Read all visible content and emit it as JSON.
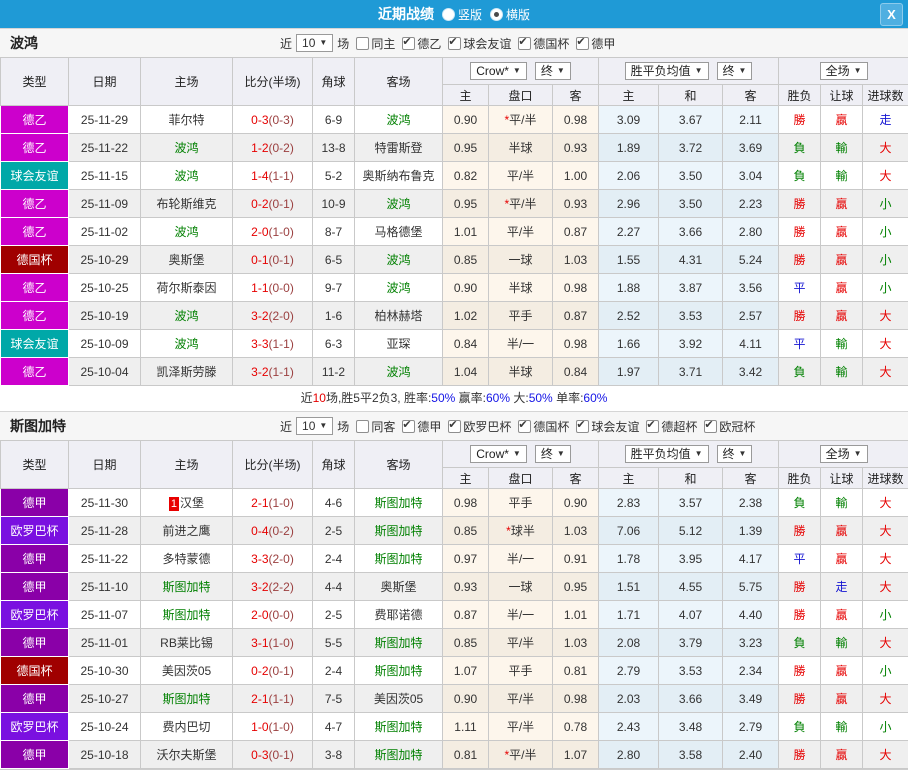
{
  "titlebar": {
    "title": "近期战绩",
    "layout_options": [
      {
        "label": "竖版",
        "selected": false
      },
      {
        "label": "横版",
        "selected": true
      }
    ],
    "close_label": "X"
  },
  "header_labels": {
    "near": "近",
    "games": "场",
    "main_cols": [
      "类型",
      "日期",
      "主场",
      "比分(半场)",
      "角球",
      "客场"
    ],
    "sub_cols": [
      "主",
      "盘口",
      "客",
      "主",
      "和",
      "客",
      "胜负",
      "让球",
      "进球数"
    ],
    "odds_source": "Crow*",
    "odds_final": "终",
    "avg_label": "胜平负均值",
    "avg_final": "终",
    "scope_label": "全场"
  },
  "league_colors": {
    "德乙": "#CC00CC",
    "球会友谊": "#00A8A8",
    "德国杯": "#A00000",
    "德甲": "#8A00A8",
    "欧罗巴杯": "#7A10E0"
  },
  "sections": [
    {
      "team": "波鸿",
      "filter": {
        "count": "10",
        "same": {
          "label": "同主",
          "checked": false
        },
        "leagues": [
          {
            "label": "德乙",
            "checked": true
          },
          {
            "label": "球会友谊",
            "checked": true
          },
          {
            "label": "德国杯",
            "checked": true
          },
          {
            "label": "德甲",
            "checked": true
          }
        ]
      },
      "rows": [
        {
          "lg": "德乙",
          "date": "25-11-29",
          "home": "菲尔特",
          "hg": false,
          "ft": "0-3",
          "ht": "(0-3)",
          "cn": "6-9",
          "away": "波鸿",
          "ag": true,
          "o1": "0.90",
          "st": true,
          "hc": "平/半",
          "o2": "0.98",
          "a1": "3.09",
          "a2": "3.67",
          "a3": "2.11",
          "r1": "勝",
          "c1": "r",
          "r2": "贏",
          "c2": "r",
          "r3": "走",
          "c3": "b"
        },
        {
          "lg": "德乙",
          "date": "25-11-22",
          "home": "波鸿",
          "hg": true,
          "ft": "1-2",
          "ht": "(0-2)",
          "cn": "13-8",
          "away": "特雷斯登",
          "ag": false,
          "o1": "0.95",
          "st": false,
          "hc": "半球",
          "o2": "0.93",
          "a1": "1.89",
          "a2": "3.72",
          "a3": "3.69",
          "r1": "負",
          "c1": "g",
          "r2": "輸",
          "c2": "g",
          "r3": "大",
          "c3": "r"
        },
        {
          "lg": "球会友谊",
          "date": "25-11-15",
          "home": "波鸿",
          "hg": true,
          "ft": "1-4",
          "ht": "(1-1)",
          "cn": "5-2",
          "away": "奥斯纳布鲁克",
          "ag": false,
          "o1": "0.82",
          "st": false,
          "hc": "平/半",
          "o2": "1.00",
          "a1": "2.06",
          "a2": "3.50",
          "a3": "3.04",
          "r1": "負",
          "c1": "g",
          "r2": "輸",
          "c2": "g",
          "r3": "大",
          "c3": "r"
        },
        {
          "lg": "德乙",
          "date": "25-11-09",
          "home": "布轮斯维克",
          "hg": false,
          "ft": "0-2",
          "ht": "(0-1)",
          "cn": "10-9",
          "away": "波鸿",
          "ag": true,
          "o1": "0.95",
          "st": true,
          "hc": "平/半",
          "o2": "0.93",
          "a1": "2.96",
          "a2": "3.50",
          "a3": "2.23",
          "r1": "勝",
          "c1": "r",
          "r2": "贏",
          "c2": "r",
          "r3": "小",
          "c3": "g"
        },
        {
          "lg": "德乙",
          "date": "25-11-02",
          "home": "波鸿",
          "hg": true,
          "ft": "2-0",
          "ht": "(1-0)",
          "cn": "8-7",
          "away": "马格德堡",
          "ag": false,
          "o1": "1.01",
          "st": false,
          "hc": "平/半",
          "o2": "0.87",
          "a1": "2.27",
          "a2": "3.66",
          "a3": "2.80",
          "r1": "勝",
          "c1": "r",
          "r2": "贏",
          "c2": "r",
          "r3": "小",
          "c3": "g"
        },
        {
          "lg": "德国杯",
          "date": "25-10-29",
          "home": "奥斯堡",
          "hg": false,
          "ft": "0-1",
          "ht": "(0-1)",
          "cn": "6-5",
          "away": "波鸿",
          "ag": true,
          "o1": "0.85",
          "st": false,
          "hc": "一球",
          "o2": "1.03",
          "a1": "1.55",
          "a2": "4.31",
          "a3": "5.24",
          "r1": "勝",
          "c1": "r",
          "r2": "贏",
          "c2": "r",
          "r3": "小",
          "c3": "g"
        },
        {
          "lg": "德乙",
          "date": "25-10-25",
          "home": "荷尔斯泰因",
          "hg": false,
          "ft": "1-1",
          "ht": "(0-0)",
          "cn": "9-7",
          "away": "波鸿",
          "ag": true,
          "o1": "0.90",
          "st": false,
          "hc": "半球",
          "o2": "0.98",
          "a1": "1.88",
          "a2": "3.87",
          "a3": "3.56",
          "r1": "平",
          "c1": "b",
          "r2": "贏",
          "c2": "r",
          "r3": "小",
          "c3": "g"
        },
        {
          "lg": "德乙",
          "date": "25-10-19",
          "home": "波鸿",
          "hg": true,
          "ft": "3-2",
          "ht": "(2-0)",
          "cn": "1-6",
          "away": "柏林赫塔",
          "ag": false,
          "o1": "1.02",
          "st": false,
          "hc": "平手",
          "o2": "0.87",
          "a1": "2.52",
          "a2": "3.53",
          "a3": "2.57",
          "r1": "勝",
          "c1": "r",
          "r2": "贏",
          "c2": "r",
          "r3": "大",
          "c3": "r"
        },
        {
          "lg": "球会友谊",
          "date": "25-10-09",
          "home": "波鸿",
          "hg": true,
          "ft": "3-3",
          "ht": "(1-1)",
          "cn": "6-3",
          "away": "亚琛",
          "ag": false,
          "o1": "0.84",
          "st": false,
          "hc": "半/一",
          "o2": "0.98",
          "a1": "1.66",
          "a2": "3.92",
          "a3": "4.11",
          "r1": "平",
          "c1": "b",
          "r2": "輸",
          "c2": "g",
          "r3": "大",
          "c3": "r"
        },
        {
          "lg": "德乙",
          "date": "25-10-04",
          "home": "凯泽斯劳滕",
          "hg": false,
          "ft": "3-2",
          "ht": "(1-1)",
          "cn": "11-2",
          "away": "波鸿",
          "ag": true,
          "o1": "1.04",
          "st": false,
          "hc": "半球",
          "o2": "0.84",
          "a1": "1.97",
          "a2": "3.71",
          "a3": "3.42",
          "r1": "負",
          "c1": "g",
          "r2": "輸",
          "c2": "g",
          "r3": "大",
          "c3": "r"
        }
      ],
      "summary": [
        [
          "近",
          "k"
        ],
        [
          "10",
          "r"
        ],
        [
          "场,胜5平2负3, 胜率:",
          "k"
        ],
        [
          "50%",
          "b"
        ],
        [
          " 赢率:",
          "k"
        ],
        [
          "60%",
          "b"
        ],
        [
          " 大:",
          "k"
        ],
        [
          "50%",
          "b"
        ],
        [
          " 单率:",
          "k"
        ],
        [
          "60%",
          "b"
        ]
      ]
    },
    {
      "team": "斯图加特",
      "filter": {
        "count": "10",
        "same": {
          "label": "同客",
          "checked": false
        },
        "leagues": [
          {
            "label": "德甲",
            "checked": true
          },
          {
            "label": "欧罗巴杯",
            "checked": true
          },
          {
            "label": "德国杯",
            "checked": true
          },
          {
            "label": "球会友谊",
            "checked": true
          },
          {
            "label": "德超杯",
            "checked": true
          },
          {
            "label": "欧冠杯",
            "checked": true
          }
        ]
      },
      "rows": [
        {
          "lg": "德甲",
          "date": "25-11-30",
          "rank": "1",
          "home": "汉堡",
          "hg": false,
          "ft": "2-1",
          "ht": "(1-0)",
          "cn": "4-6",
          "away": "斯图加特",
          "ag": true,
          "o1": "0.98",
          "st": false,
          "hc": "平手",
          "o2": "0.90",
          "a1": "2.83",
          "a2": "3.57",
          "a3": "2.38",
          "r1": "負",
          "c1": "g",
          "r2": "輸",
          "c2": "g",
          "r3": "大",
          "c3": "r"
        },
        {
          "lg": "欧罗巴杯",
          "date": "25-11-28",
          "home": "前进之鹰",
          "hg": false,
          "ft": "0-4",
          "ht": "(0-2)",
          "cn": "2-5",
          "away": "斯图加特",
          "ag": true,
          "o1": "0.85",
          "st": true,
          "hc": "球半",
          "o2": "1.03",
          "a1": "7.06",
          "a2": "5.12",
          "a3": "1.39",
          "r1": "勝",
          "c1": "r",
          "r2": "贏",
          "c2": "r",
          "r3": "大",
          "c3": "r"
        },
        {
          "lg": "德甲",
          "date": "25-11-22",
          "home": "多特蒙德",
          "hg": false,
          "ft": "3-3",
          "ht": "(2-0)",
          "cn": "2-4",
          "away": "斯图加特",
          "ag": true,
          "o1": "0.97",
          "st": false,
          "hc": "半/一",
          "o2": "0.91",
          "a1": "1.78",
          "a2": "3.95",
          "a3": "4.17",
          "r1": "平",
          "c1": "b",
          "r2": "贏",
          "c2": "r",
          "r3": "大",
          "c3": "r"
        },
        {
          "lg": "德甲",
          "date": "25-11-10",
          "home": "斯图加特",
          "hg": true,
          "ft": "3-2",
          "ht": "(2-2)",
          "cn": "4-4",
          "away": "奥斯堡",
          "ag": false,
          "o1": "0.93",
          "st": false,
          "hc": "一球",
          "o2": "0.95",
          "a1": "1.51",
          "a2": "4.55",
          "a3": "5.75",
          "r1": "勝",
          "c1": "r",
          "r2": "走",
          "c2": "b",
          "r3": "大",
          "c3": "r"
        },
        {
          "lg": "欧罗巴杯",
          "date": "25-11-07",
          "home": "斯图加特",
          "hg": true,
          "ft": "2-0",
          "ht": "(0-0)",
          "cn": "2-5",
          "away": "费耶诺德",
          "ag": false,
          "o1": "0.87",
          "st": false,
          "hc": "半/一",
          "o2": "1.01",
          "a1": "1.71",
          "a2": "4.07",
          "a3": "4.40",
          "r1": "勝",
          "c1": "r",
          "r2": "贏",
          "c2": "r",
          "r3": "小",
          "c3": "g"
        },
        {
          "lg": "德甲",
          "date": "25-11-01",
          "home": "RB莱比锡",
          "hg": false,
          "ft": "3-1",
          "ht": "(1-0)",
          "cn": "5-5",
          "away": "斯图加特",
          "ag": true,
          "o1": "0.85",
          "st": false,
          "hc": "平/半",
          "o2": "1.03",
          "a1": "2.08",
          "a2": "3.79",
          "a3": "3.23",
          "r1": "負",
          "c1": "g",
          "r2": "輸",
          "c2": "g",
          "r3": "大",
          "c3": "r"
        },
        {
          "lg": "德国杯",
          "date": "25-10-30",
          "home": "美因茨05",
          "hg": false,
          "ft": "0-2",
          "ht": "(0-1)",
          "cn": "2-4",
          "away": "斯图加特",
          "ag": true,
          "o1": "1.07",
          "st": false,
          "hc": "平手",
          "o2": "0.81",
          "a1": "2.79",
          "a2": "3.53",
          "a3": "2.34",
          "r1": "勝",
          "c1": "r",
          "r2": "贏",
          "c2": "r",
          "r3": "小",
          "c3": "g"
        },
        {
          "lg": "德甲",
          "date": "25-10-27",
          "home": "斯图加特",
          "hg": true,
          "ft": "2-1",
          "ht": "(1-1)",
          "cn": "7-5",
          "away": "美因茨05",
          "ag": false,
          "o1": "0.90",
          "st": false,
          "hc": "平/半",
          "o2": "0.98",
          "a1": "2.03",
          "a2": "3.66",
          "a3": "3.49",
          "r1": "勝",
          "c1": "r",
          "r2": "贏",
          "c2": "r",
          "r3": "大",
          "c3": "r"
        },
        {
          "lg": "欧罗巴杯",
          "date": "25-10-24",
          "home": "费内巴切",
          "hg": false,
          "ft": "1-0",
          "ht": "(1-0)",
          "cn": "4-7",
          "away": "斯图加特",
          "ag": true,
          "o1": "1.11",
          "st": false,
          "hc": "平/半",
          "o2": "0.78",
          "a1": "2.43",
          "a2": "3.48",
          "a3": "2.79",
          "r1": "負",
          "c1": "g",
          "r2": "輸",
          "c2": "g",
          "r3": "小",
          "c3": "g"
        },
        {
          "lg": "德甲",
          "date": "25-10-18",
          "home": "沃尔夫斯堡",
          "hg": false,
          "ft": "0-3",
          "ht": "(0-1)",
          "cn": "3-8",
          "away": "斯图加特",
          "ag": true,
          "o1": "0.81",
          "st": true,
          "hc": "平/半",
          "o2": "1.07",
          "a1": "2.80",
          "a2": "3.58",
          "a3": "2.40",
          "r1": "勝",
          "c1": "r",
          "r2": "贏",
          "c2": "r",
          "r3": "大",
          "c3": "r"
        }
      ],
      "summary": null
    }
  ]
}
